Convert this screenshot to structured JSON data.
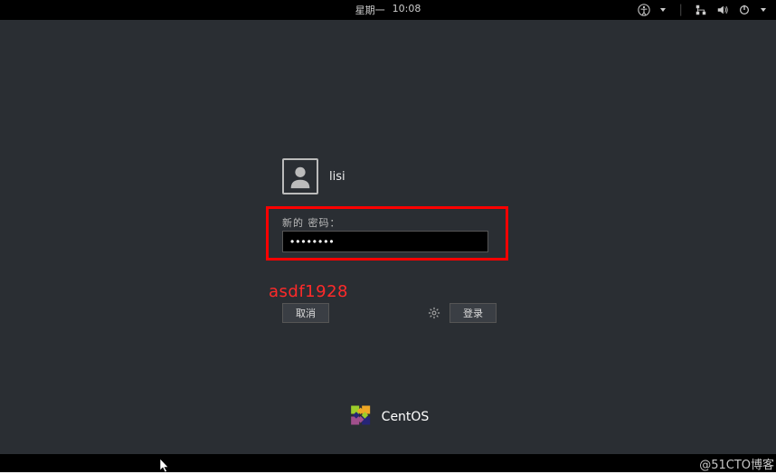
{
  "topbar": {
    "day": "星期一",
    "time": "10:08"
  },
  "tray": {
    "accessibility": "accessibility-icon",
    "network": "network-icon",
    "volume": "volume-icon",
    "power": "power-icon"
  },
  "user": {
    "name": "lisi"
  },
  "password": {
    "label": "新的 密码：",
    "value": "••••••••"
  },
  "annotation": {
    "text": "asdf1928"
  },
  "buttons": {
    "cancel": "取消",
    "login": "登录"
  },
  "branding": {
    "name": "CentOS"
  },
  "watermark": {
    "text": "@51CTO博客"
  }
}
